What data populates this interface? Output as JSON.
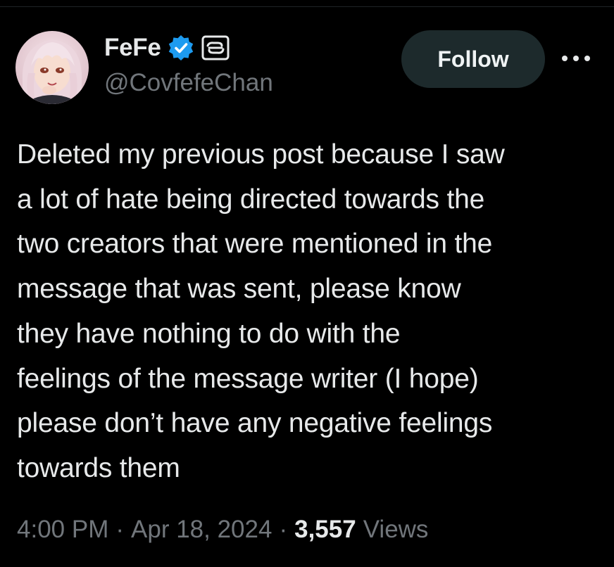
{
  "author": {
    "display_name": "FeFe",
    "handle": "@CovfefeChan",
    "verified_icon": "verified-badge-icon",
    "affiliate_icon": "affiliate-badge-icon",
    "avatar": "anime-girl-avatar"
  },
  "actions": {
    "follow_label": "Follow",
    "more_icon": "more-options-icon"
  },
  "tweet": {
    "text": "Deleted my previous post because I saw\na lot of hate being directed towards the\ntwo creators that were mentioned in the\nmessage that was sent, please know\nthey have nothing to do with the\nfeelings of the message writer (I hope)\nplease don’t have any negative feelings\ntowards them"
  },
  "meta": {
    "time": "4:00 PM",
    "separator": "·",
    "date": "Apr 18, 2024",
    "views_count": "3,557",
    "views_label": "Views"
  },
  "colors": {
    "background": "#000000",
    "text": "#e7e9ea",
    "secondary_text": "#71767b",
    "verified_blue": "#1d9bf0",
    "follow_button_bg": "#1d2a2c"
  }
}
